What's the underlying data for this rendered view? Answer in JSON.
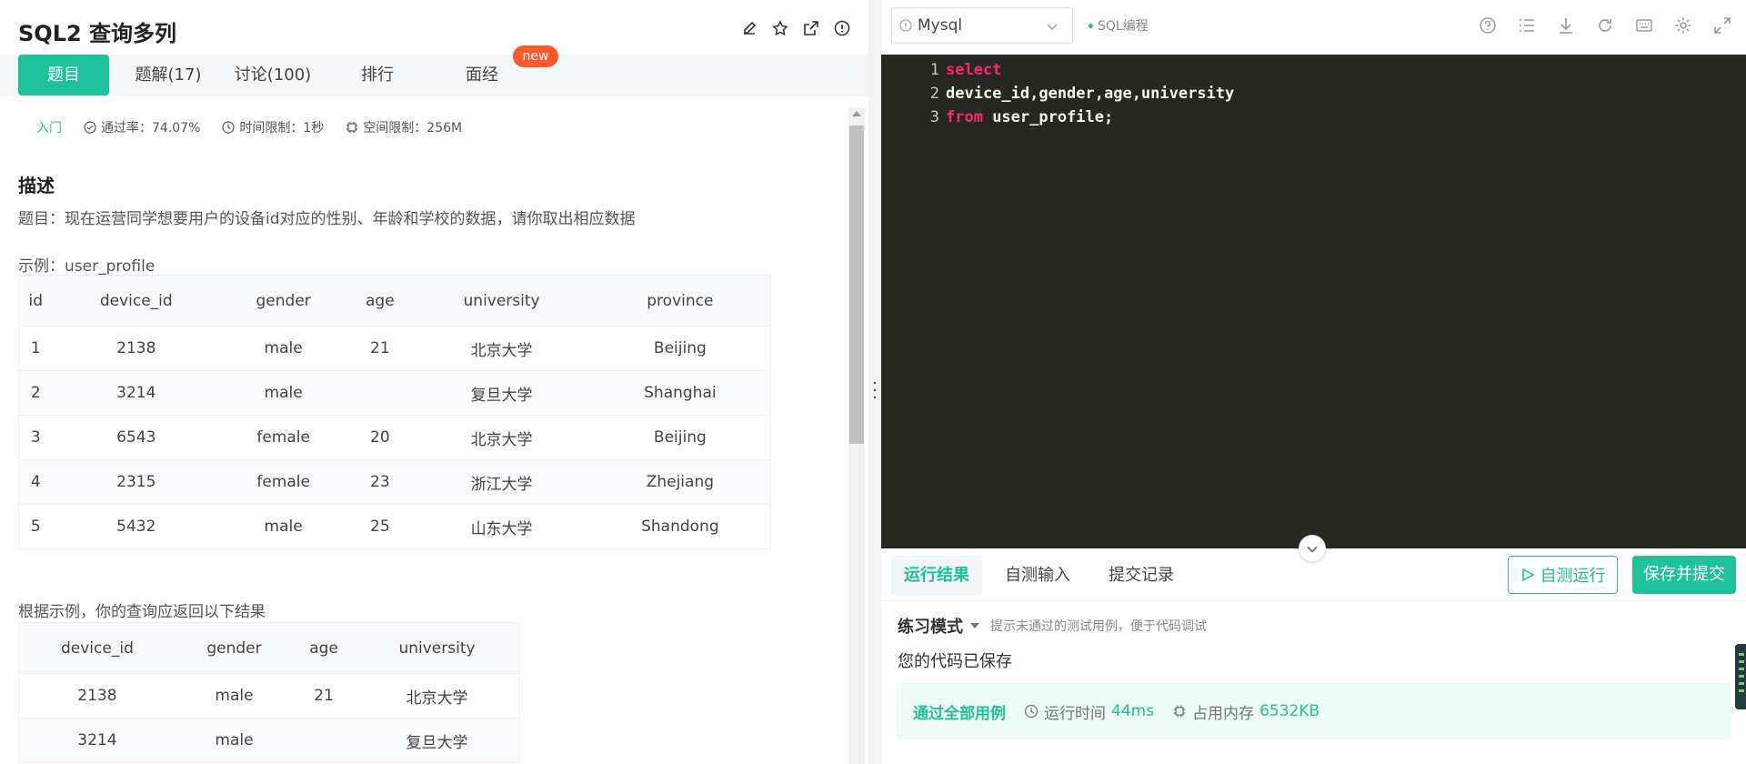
{
  "problem": {
    "title": "SQL2  查询多列",
    "tabs": [
      {
        "label": "题目"
      },
      {
        "label": "题解(17)"
      },
      {
        "label": "讨论(100)"
      },
      {
        "label": "排行"
      },
      {
        "label": "面经"
      }
    ],
    "new_badge": "new",
    "meta": {
      "level": "入门",
      "pass_rate": "通过率：74.07%",
      "time_limit": "时间限制：1秒",
      "space_limit": "空间限制：256M"
    },
    "section_title": "描述",
    "description": "题目：现在运营同学想要用户的设备id对应的性别、年龄和学校的数据，请你取出相应数据",
    "example_label": "示例：user_profile",
    "example_table": {
      "headers": [
        "id",
        "device_id",
        "gender",
        "age",
        "university",
        "province"
      ],
      "rows": [
        [
          "1",
          "2138",
          "male",
          "21",
          "北京大学",
          "Beijing"
        ],
        [
          "2",
          "3214",
          "male",
          "",
          "复旦大学",
          "Shanghai"
        ],
        [
          "3",
          "6543",
          "female",
          "20",
          "北京大学",
          "Beijing"
        ],
        [
          "4",
          "2315",
          "female",
          "23",
          "浙江大学",
          "Zhejiang"
        ],
        [
          "5",
          "5432",
          "male",
          "25",
          "山东大学",
          "Shandong"
        ]
      ]
    },
    "result_label": "根据示例，你的查询应返回以下结果",
    "result_table": {
      "headers": [
        "device_id",
        "gender",
        "age",
        "university"
      ],
      "rows": [
        [
          "2138",
          "male",
          "21",
          "北京大学"
        ],
        [
          "3214",
          "male",
          "",
          "复旦大学"
        ]
      ]
    }
  },
  "editor": {
    "language": "Mysql",
    "mode_tag": "SQL编程",
    "lines": [
      {
        "no": "1",
        "keyword": "select",
        "text": ""
      },
      {
        "no": "2",
        "keyword": "",
        "text": "device_id,gender,age,university"
      },
      {
        "no": "3",
        "keyword": "from",
        "text": " user_profile;"
      }
    ],
    "colors": {
      "background": "#272822",
      "keyword": "#f92672",
      "text": "#f8f8f2"
    }
  },
  "results": {
    "tabs": [
      {
        "label": "运行结果"
      },
      {
        "label": "自测输入"
      },
      {
        "label": "提交记录"
      }
    ],
    "self_test_button": "自测运行",
    "submit_button": "保存并提交",
    "practice_mode": "练习模式",
    "practice_hint": "提示未通过的测试用例，便于代码调试",
    "saved_message": "您的代码已保存",
    "pass_title": "通过全部用例",
    "run_time_label": "运行时间",
    "run_time_value": "44ms",
    "memory_label": "占用内存",
    "memory_value": "6532KB"
  },
  "theme": {
    "accent": "#1fc29a",
    "badge": "#fb5a2e"
  }
}
